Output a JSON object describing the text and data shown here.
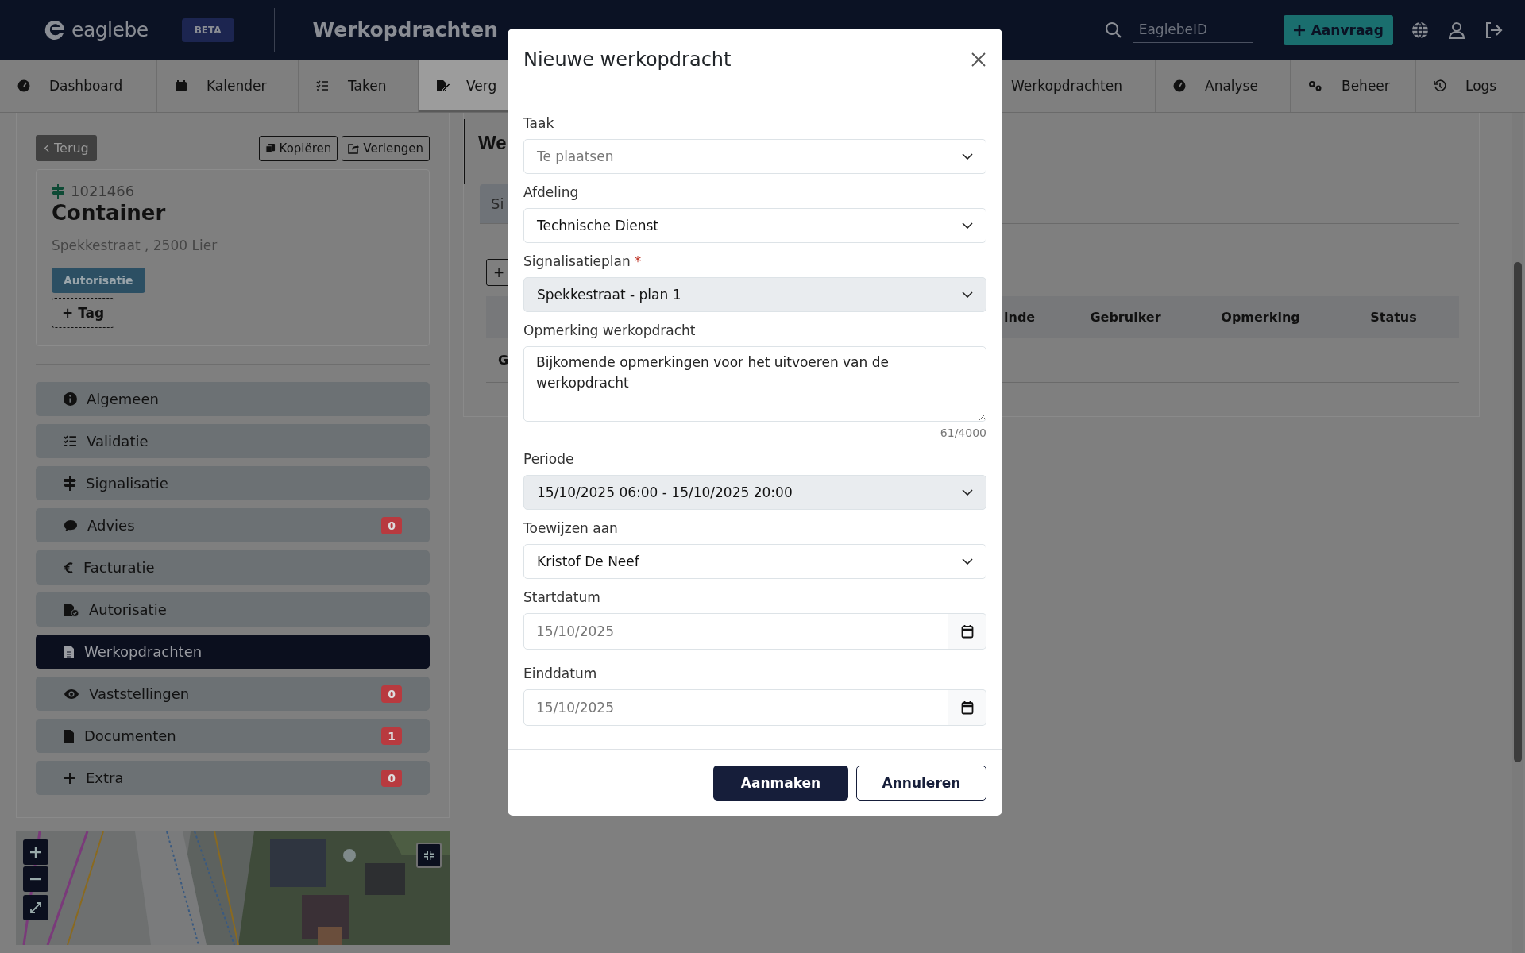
{
  "topbar": {
    "logo": "eaglebe",
    "badge": "BETA",
    "title": "Werkopdrachten",
    "search": {
      "placeholder": "EaglebeID"
    },
    "request_button": "Aanvraag"
  },
  "nav": [
    {
      "label": "Dashboard",
      "selected": false
    },
    {
      "label": "Kalender",
      "selected": false
    },
    {
      "label": "Taken",
      "selected": false
    },
    {
      "label": "Verg",
      "selected": true
    },
    {
      "label": "Werkopdrachten",
      "selected": false
    },
    {
      "label": "Analyse",
      "selected": false
    },
    {
      "label": "Beheer",
      "selected": false
    },
    {
      "label": "Logs",
      "selected": false
    }
  ],
  "record": {
    "back": "Terug",
    "actions": [
      "Kopiëren",
      "Verlengen"
    ],
    "number": "1021466",
    "title": "Container",
    "address": "Spekkestraat , 2500 Lier",
    "tag": "Autorisatie",
    "add_tag": "+ Tag"
  },
  "sections": [
    {
      "label": "Algemeen",
      "selected": false
    },
    {
      "label": "Validatie",
      "selected": false
    },
    {
      "label": "Signalisatie",
      "selected": false
    },
    {
      "label": "Advies",
      "selected": false,
      "badge": "0"
    },
    {
      "label": "Facturatie",
      "selected": false
    },
    {
      "label": "Autorisatie",
      "selected": false
    },
    {
      "label": "Werkopdrachten",
      "selected": true
    },
    {
      "label": "Vaststellingen",
      "selected": false,
      "badge": "0"
    },
    {
      "label": "Documenten",
      "selected": false,
      "badge": "1"
    },
    {
      "label": "Extra",
      "selected": false,
      "badge": "0"
    }
  ],
  "content": {
    "title": "We",
    "tab": "Si",
    "add_button": "+",
    "columns": [
      "inde",
      "Gebruiker",
      "Opmerking",
      "Status"
    ],
    "rows": [
      [
        "G"
      ]
    ]
  },
  "modal": {
    "title": "Nieuwe werkopdracht",
    "fields": [
      {
        "kind": "select",
        "label": "Taak",
        "placeholder": "Te plaatsen",
        "disabled": false
      },
      {
        "kind": "select",
        "label": "Afdeling",
        "value": "Technische Dienst",
        "disabled": false
      },
      {
        "kind": "select",
        "label": "Signalisatieplan",
        "required_mark": "*",
        "value": "Spekkestraat - plan 1",
        "disabled": true
      },
      {
        "kind": "textarea",
        "label": "Opmerking werkopdracht",
        "value": "Bijkomende opmerkingen voor het uitvoeren van de werkopdracht",
        "counter": "61/4000"
      },
      {
        "kind": "select",
        "label": "Periode",
        "value": "15/10/2025 06:00 - 15/10/2025 20:00",
        "disabled": true
      },
      {
        "kind": "select",
        "label": "Toewijzen aan",
        "value": "Kristof De Neef",
        "disabled": false
      },
      {
        "kind": "date",
        "label": "Startdatum",
        "placeholder": "15/10/2025"
      },
      {
        "kind": "date",
        "label": "Einddatum",
        "placeholder": "15/10/2025"
      }
    ],
    "buttons": [
      {
        "label": "Aanmaken",
        "kind": "primary"
      },
      {
        "label": "Annuleren",
        "kind": "secondary"
      }
    ]
  }
}
